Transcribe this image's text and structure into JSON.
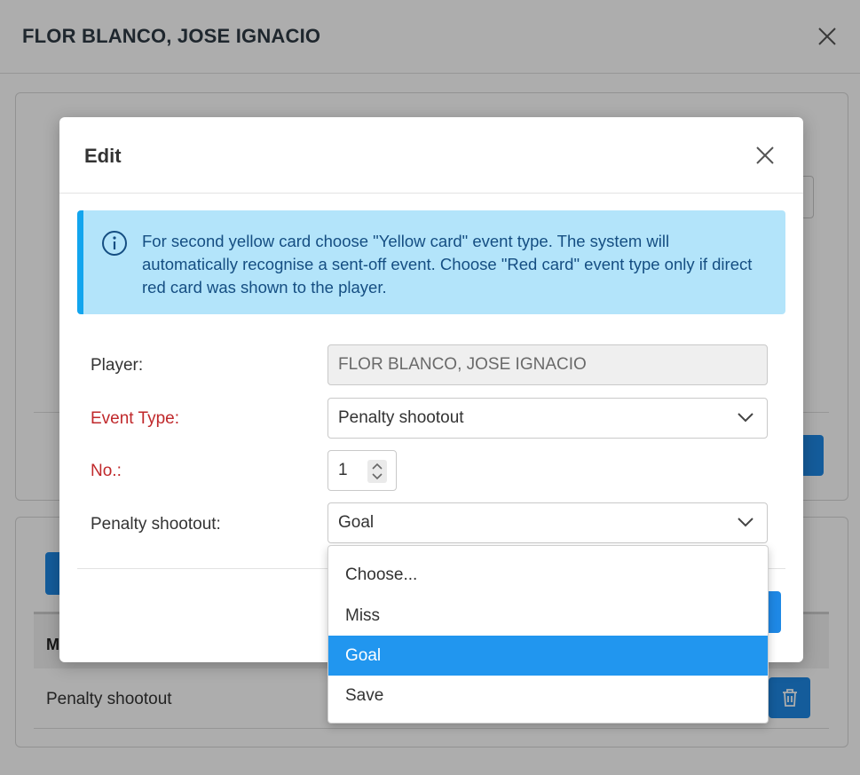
{
  "page": {
    "title": "FLOR BLANCO, JOSE IGNACIO",
    "table_header_first": "M",
    "table_row_label": "Penalty shootout"
  },
  "modal": {
    "title": "Edit",
    "alert_text": "For second yellow card choose \"Yellow card\" event type. The system will automatically recognise a sent-off event. Choose \"Red card\" event type only if direct red card was shown to the player.",
    "form": {
      "player_label": "Player:",
      "player_value": "FLOR BLANCO, JOSE IGNACIO",
      "event_type_label": "Event Type:",
      "event_type_value": "Penalty shootout",
      "no_label": "No.:",
      "no_value": "1",
      "penalty_label": "Penalty shootout:",
      "penalty_value": "Goal"
    }
  },
  "dropdown": {
    "options": [
      "Choose...",
      "Miss",
      "Goal",
      "Save"
    ],
    "selected": "Goal"
  },
  "colors": {
    "accent": "#1e88e5",
    "alert_bg": "#b3e4fa",
    "alert_border": "#12a5ee",
    "required_label": "#c0282b",
    "selected_option": "#2196ef"
  },
  "icons": {
    "page_close": "close-icon",
    "modal_close": "close-icon",
    "alert": "info-circle-icon",
    "select_arrow": "chevron-down-icon",
    "delete": "trash-icon",
    "spinner": "spinner-arrows-icon"
  }
}
